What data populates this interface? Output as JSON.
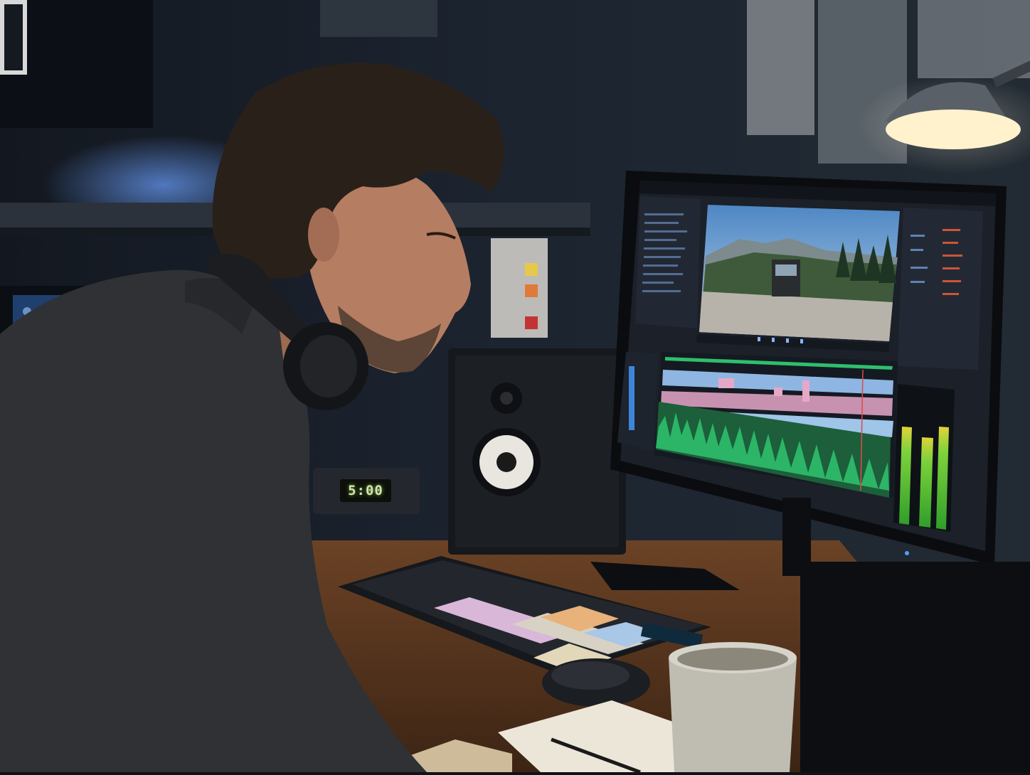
{
  "scene": {
    "description_tag": "video-editing-workstation",
    "desk_clock": {
      "display": "5:00"
    }
  },
  "colors": {
    "audio_waveform": "#2fbf6d",
    "level_meter": "#57c93a",
    "timeline_clip_pink": "#e6a8c8",
    "timeline_clip_blue": "#9fc5e8",
    "ui_background": "#1b2029",
    "wall": "#1a2029"
  },
  "icons": [
    "headphones-icon",
    "mouse-icon",
    "mug-icon",
    "desk-lamp-icon",
    "studio-speaker-icon"
  ]
}
